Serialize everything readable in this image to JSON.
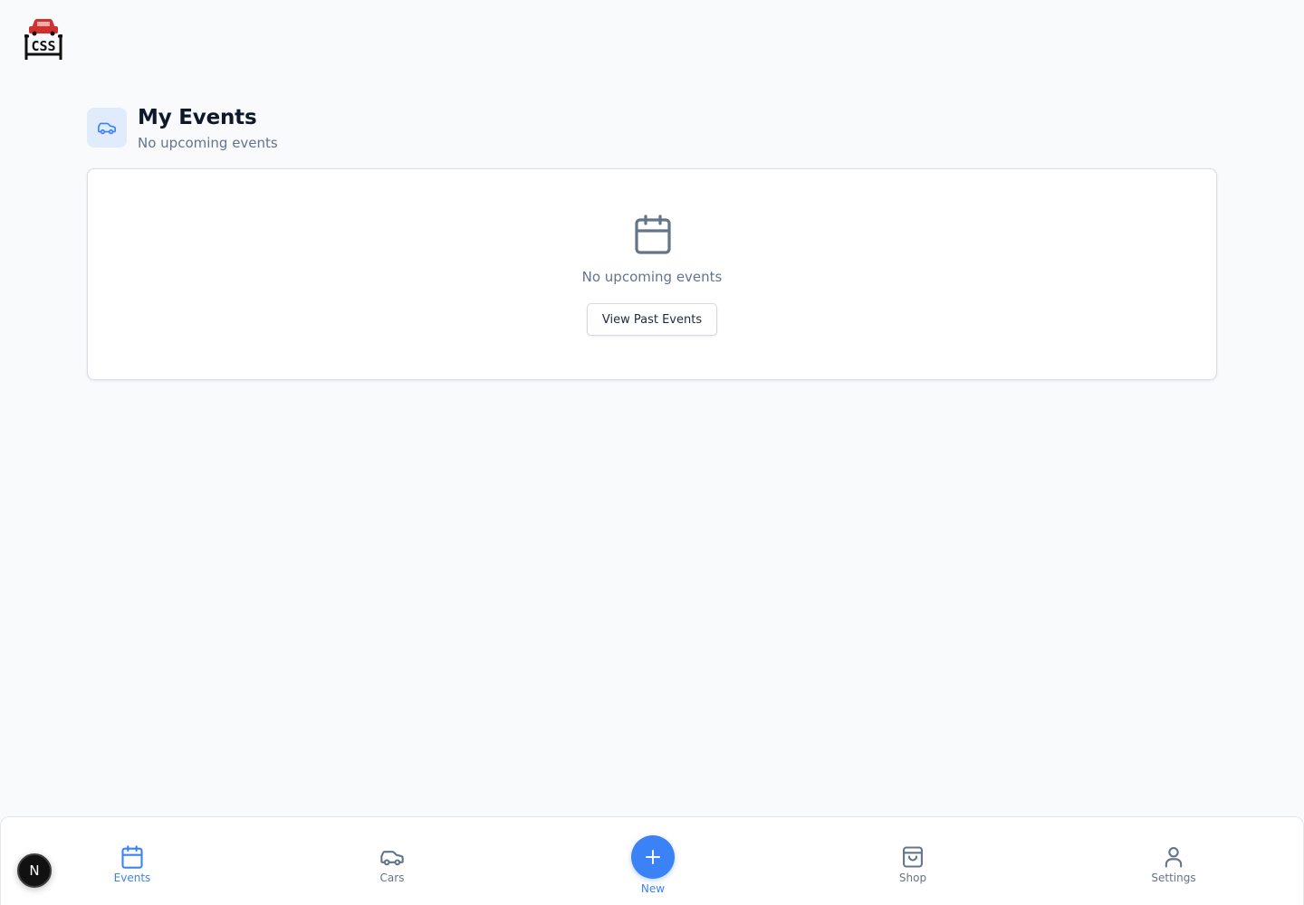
{
  "header": {
    "title": "My Events",
    "subtitle": "No upcoming events"
  },
  "empty_state": {
    "message": "No upcoming events",
    "button_label": "View Past Events"
  },
  "nav": {
    "items": [
      {
        "label": "Events",
        "icon": "calendar-icon",
        "active": true
      },
      {
        "label": "Cars",
        "icon": "car-icon",
        "active": false
      },
      {
        "label": "New",
        "icon": "plus-icon",
        "active": false
      },
      {
        "label": "Shop",
        "icon": "shopping-bag-icon",
        "active": false
      },
      {
        "label": "Settings",
        "icon": "user-icon",
        "active": false
      }
    ]
  },
  "badge": {
    "letter": "N"
  },
  "colors": {
    "accent": "#3b82f6",
    "background": "#f8fafc",
    "muted_text": "#64748b",
    "logo_red": "#d32f2f"
  }
}
